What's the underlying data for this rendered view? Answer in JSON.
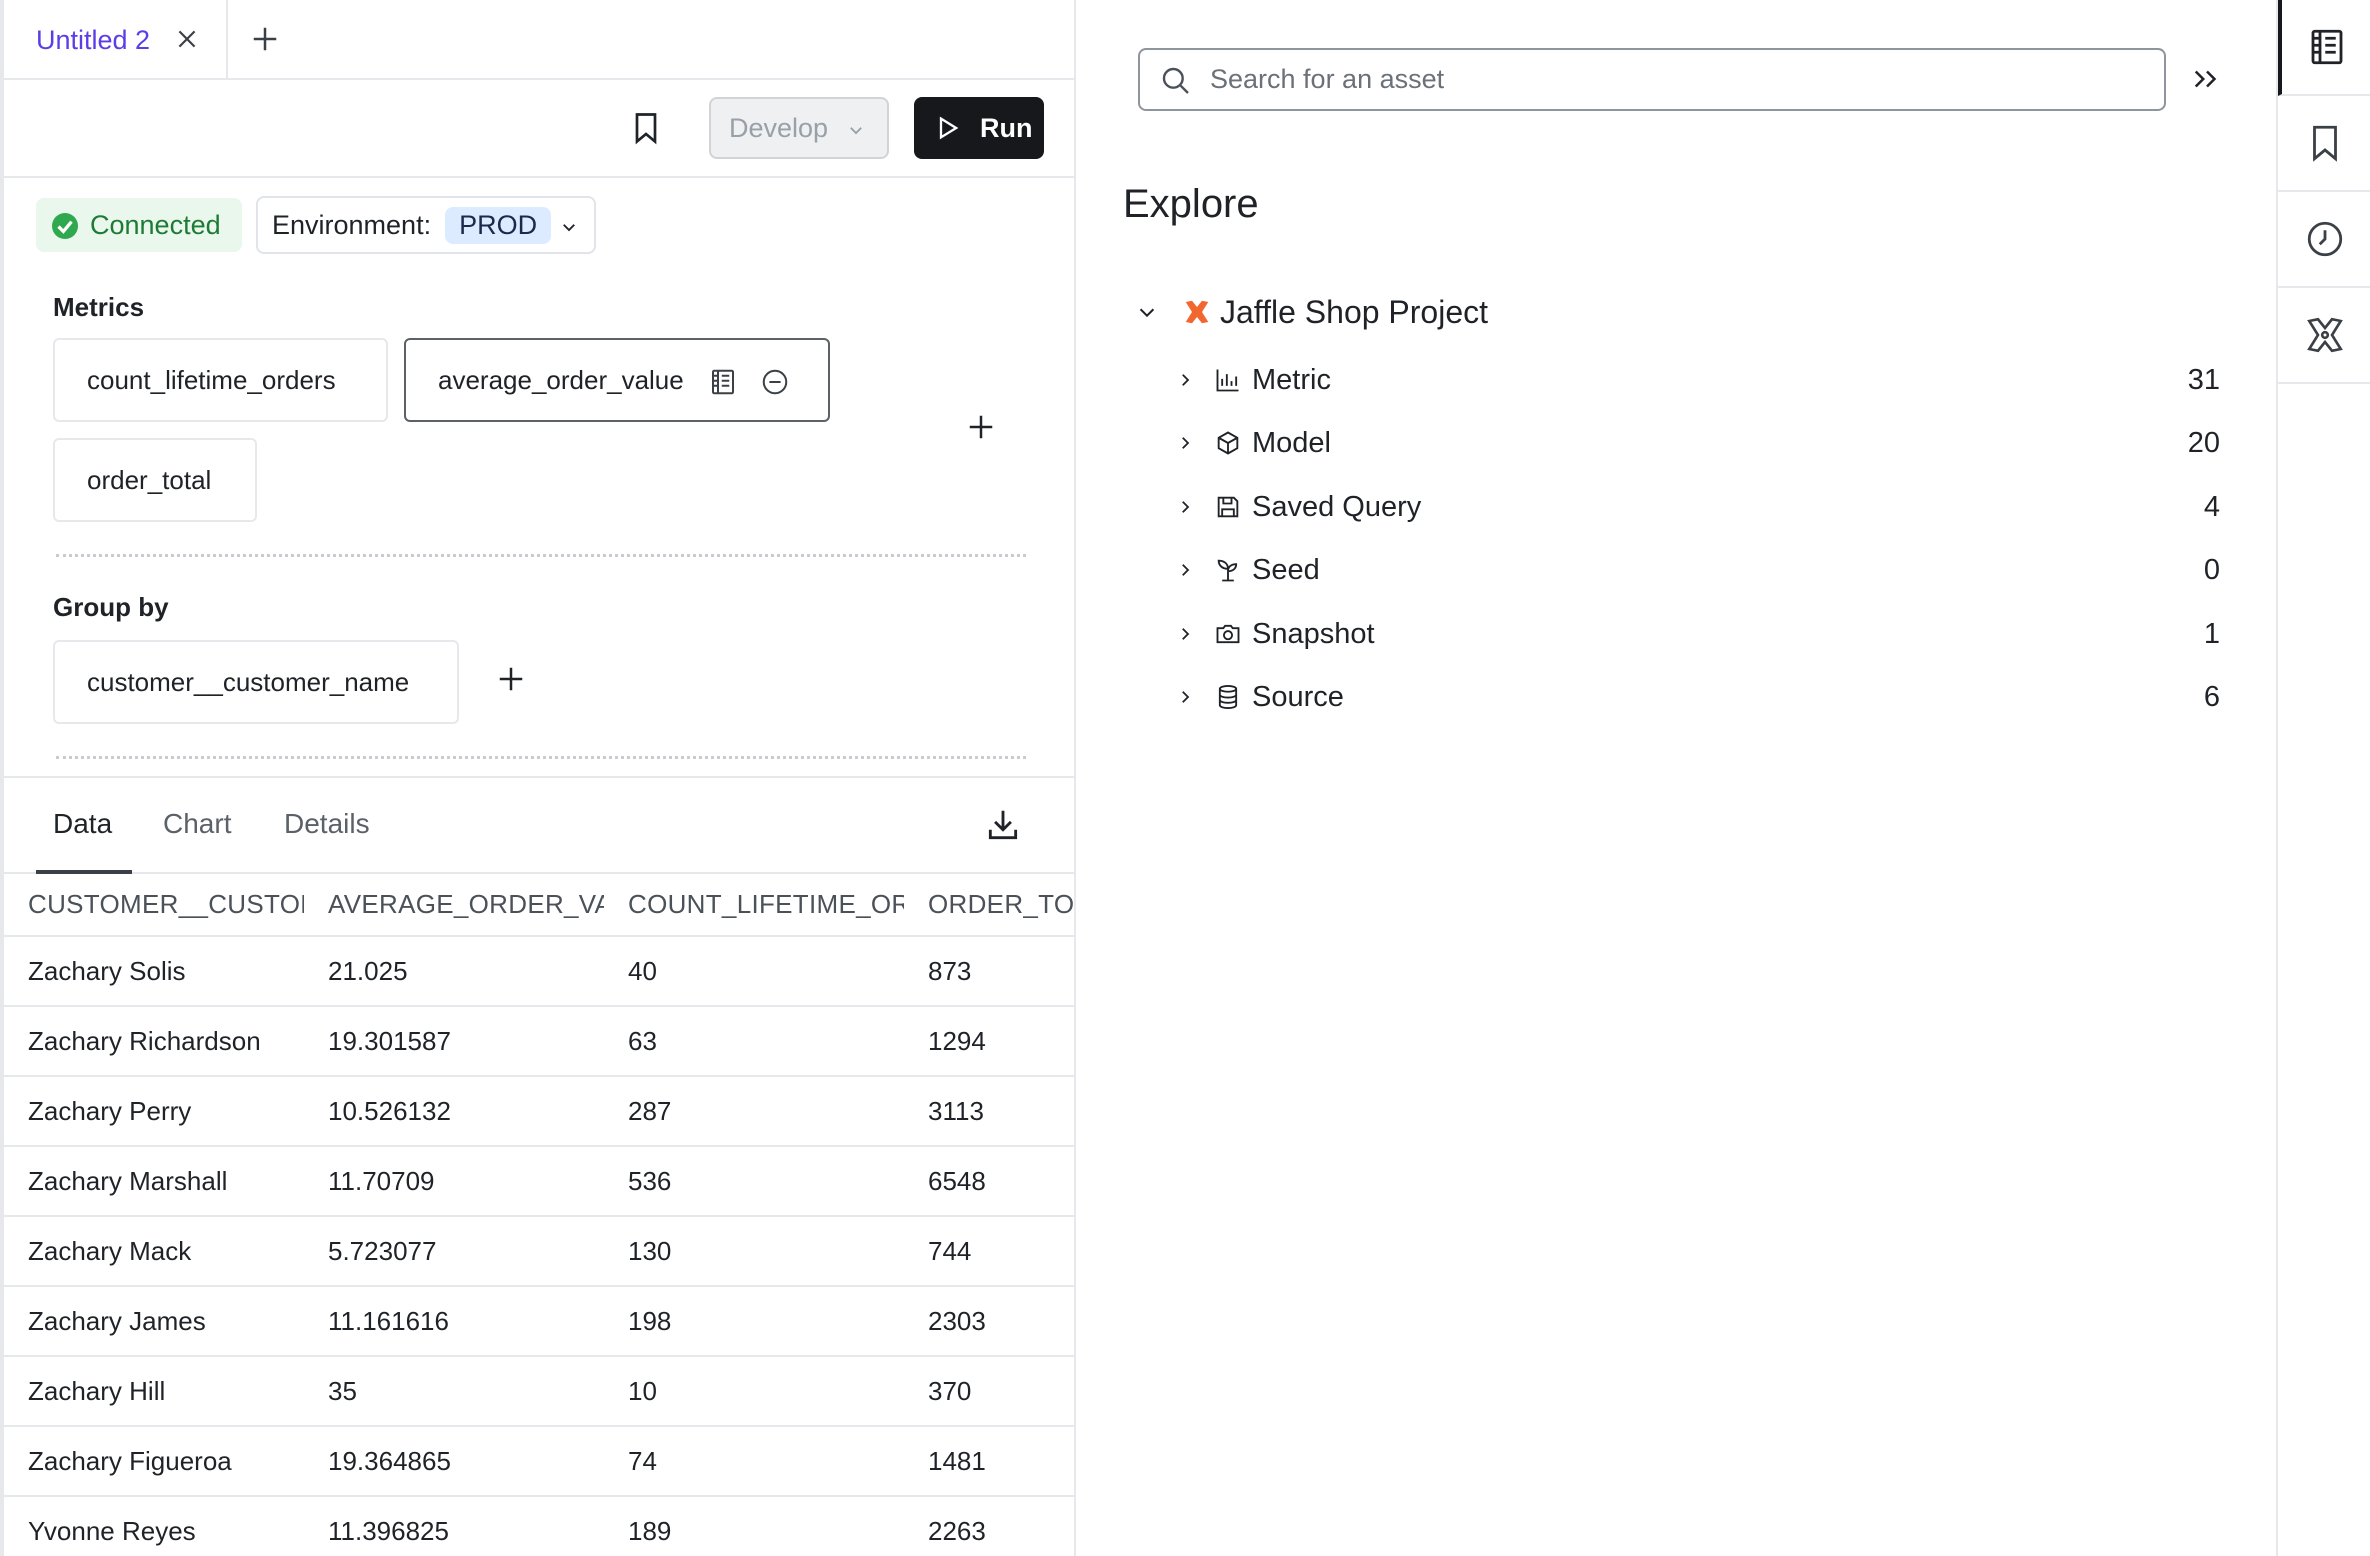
{
  "tabs": [
    {
      "label": "Untitled 2"
    }
  ],
  "toolbar": {
    "develop_label": "Develop",
    "run_label": "Run"
  },
  "connection": {
    "status": "Connected",
    "env_label": "Environment:",
    "env_value": "PROD"
  },
  "metrics": {
    "title": "Metrics",
    "items": [
      "count_lifetime_orders",
      "average_order_value",
      "order_total"
    ]
  },
  "group_by": {
    "title": "Group by",
    "items": [
      "customer__customer_name"
    ]
  },
  "results": {
    "tabs": [
      "Data",
      "Chart",
      "Details"
    ],
    "columns": [
      "CUSTOMER__CUSTOMER_NAME",
      "AVERAGE_ORDER_VALUE",
      "COUNT_LIFETIME_ORDERS",
      "ORDER_TOTAL"
    ],
    "rows": [
      [
        "Zachary Solis",
        "21.025",
        "40",
        "873"
      ],
      [
        "Zachary Richardson",
        "19.301587",
        "63",
        "1294"
      ],
      [
        "Zachary Perry",
        "10.526132",
        "287",
        "3113"
      ],
      [
        "Zachary Marshall",
        "11.70709",
        "536",
        "6548"
      ],
      [
        "Zachary Mack",
        "5.723077",
        "130",
        "744"
      ],
      [
        "Zachary James",
        "11.161616",
        "198",
        "2303"
      ],
      [
        "Zachary Hill",
        "35",
        "10",
        "370"
      ],
      [
        "Zachary Figueroa",
        "19.364865",
        "74",
        "1481"
      ],
      [
        "Yvonne Reyes",
        "11.396825",
        "189",
        "2263"
      ]
    ]
  },
  "explore": {
    "search_placeholder": "Search for an asset",
    "title": "Explore",
    "project": "Jaffle Shop Project",
    "nodes": [
      {
        "label": "Metric",
        "count": "31",
        "icon": "bar-chart-icon"
      },
      {
        "label": "Model",
        "count": "20",
        "icon": "cube-icon"
      },
      {
        "label": "Saved Query",
        "count": "4",
        "icon": "save-icon"
      },
      {
        "label": "Seed",
        "count": "0",
        "icon": "sprout-icon"
      },
      {
        "label": "Snapshot",
        "count": "1",
        "icon": "camera-icon"
      },
      {
        "label": "Source",
        "count": "6",
        "icon": "database-icon"
      }
    ]
  },
  "rail": [
    "catalog-icon",
    "bookmark-icon",
    "history-icon",
    "dbt-icon"
  ],
  "colors": {
    "accent": "#5b3ee6",
    "run_bg": "#16181c",
    "connected": "#2fa84f",
    "env_pill": "#dcebff",
    "dbt_orange": "#f2672f"
  }
}
